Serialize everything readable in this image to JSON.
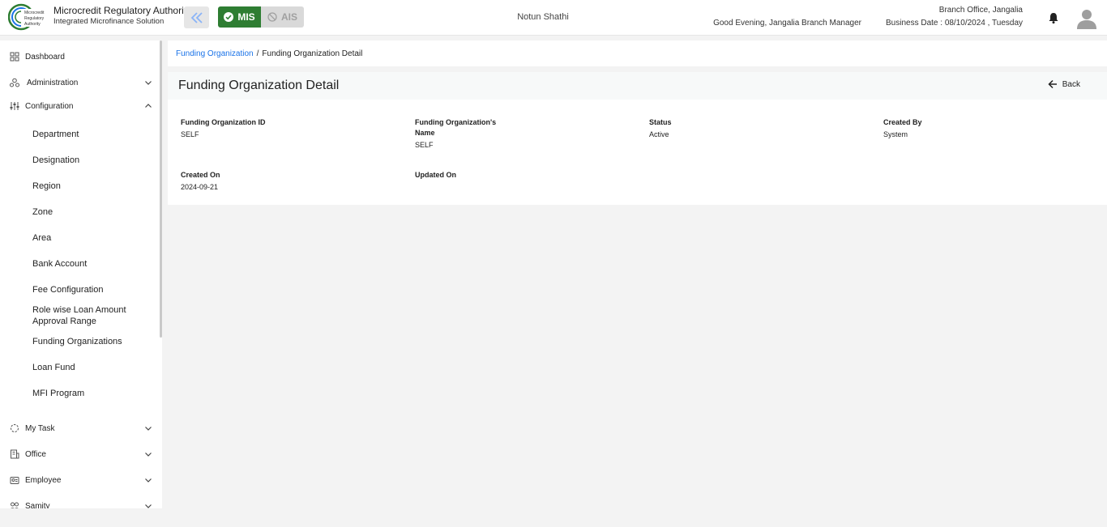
{
  "header": {
    "org_name": "Microcredit Regulatory Authority",
    "org_sub": "Integrated Microfinance Solution",
    "logo_text": "Microcredit Regulatory Authority",
    "mis_label": "MIS",
    "ais_label": "AIS",
    "app_name": "Notun Shathi",
    "greeting": "Good Evening, Jangalia Branch Manager",
    "branch": "Branch Office, Jangalia",
    "business_date": "Business Date : 08/10/2024 , Tuesday",
    "colors": {
      "mis": "#2e7d32",
      "ais": "#d9d9d9",
      "accent": "#1a73e8"
    }
  },
  "sidebar": {
    "dashboard": "Dashboard",
    "administration": "Administration",
    "configuration": "Configuration",
    "config_items": [
      "Department",
      "Designation",
      "Region",
      "Zone",
      "Area",
      "Bank Account",
      "Fee Configuration",
      "Role wise Loan Amount Approval Range",
      "Funding Organizations",
      "Loan Fund",
      "MFI Program"
    ],
    "my_task": "My Task",
    "office": "Office",
    "employee": "Employee",
    "samity": "Samity"
  },
  "breadcrumb": {
    "link": "Funding Organization",
    "separator": "/",
    "current": "Funding Organization Detail"
  },
  "page": {
    "title": "Funding Organization Detail",
    "back": "Back"
  },
  "details": {
    "id_label": "Funding Organization ID",
    "id_value": "SELF",
    "name_label": "Funding Organization's Name",
    "name_value": "SELF",
    "status_label": "Status",
    "status_value": "Active",
    "created_by_label": "Created By",
    "created_by_value": "System",
    "created_on_label": "Created On",
    "created_on_value": "2024-09-21",
    "updated_on_label": "Updated On",
    "updated_on_value": ""
  }
}
